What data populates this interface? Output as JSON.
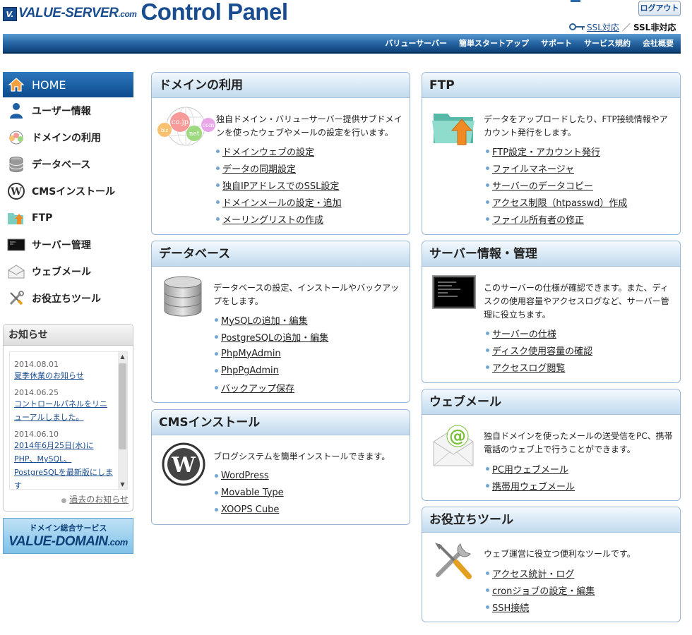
{
  "header": {
    "logo_mark": "V.",
    "brand": "VALUE-SERVER",
    "brand_suffix": ".com",
    "title": "Control Panel",
    "logout_label": "ログアウト",
    "ssl_on_label": "SSL対応",
    "ssl_separator": "／",
    "ssl_off_label": "SSL非対応"
  },
  "topnav": {
    "items": [
      "バリューサーバー",
      "簡単スタートアップ",
      "サポート",
      "サービス規約",
      "会社概要"
    ]
  },
  "sidebar": {
    "items": [
      {
        "label": "HOME",
        "icon": "home-icon"
      },
      {
        "label": "ユーザー情報",
        "icon": "user-icon"
      },
      {
        "label": "ドメインの利用",
        "icon": "domain-icon"
      },
      {
        "label": "データベース",
        "icon": "database-icon"
      },
      {
        "label": "CMSインストール",
        "icon": "wordpress-icon"
      },
      {
        "label": "FTP",
        "icon": "ftp-folder-icon"
      },
      {
        "label": "サーバー管理",
        "icon": "server-icon"
      },
      {
        "label": "ウェブメール",
        "icon": "mail-icon"
      },
      {
        "label": "お役立ちツール",
        "icon": "tools-icon"
      }
    ]
  },
  "news": {
    "title": "お知らせ",
    "items": [
      {
        "date": "2014.08.01",
        "text": "夏季休業のお知らせ"
      },
      {
        "date": "2014.06.25",
        "text": "コントロールパネルをリニューアルしました。"
      },
      {
        "date": "2014.06.10",
        "text": "2014年6月25日(水)にPHP、MySQL、PostgreSQLを最新版にします"
      }
    ],
    "past_link": "過去のお知らせ"
  },
  "banner": {
    "top": "ドメイン総合サービス",
    "main": "VALUE-DOMAIN",
    "suffix": ".com"
  },
  "panels": {
    "domain": {
      "title": "ドメインの利用",
      "icon_labels": [
        "biz",
        "co.jp",
        "net",
        "com"
      ],
      "desc": "独自ドメイン・バリューサーバー提供サブドメインを使ったウェブやメールの設定を行います。",
      "links": [
        "ドメインウェブの設定",
        "データの同期設定",
        "独自IPアドレスでのSSL設定",
        "ドメインメールの設定・追加",
        "メーリングリストの作成"
      ]
    },
    "ftp": {
      "title": "FTP",
      "desc": "データをアップロードしたり、FTP接続情報やアカウント発行をします。",
      "links": [
        "FTP設定・アカウント発行",
        "ファイルマネージャ",
        "サーバーのデータコピー",
        "アクセス制限（htpasswd）作成",
        "ファイル所有者の修正"
      ]
    },
    "database": {
      "title": "データベース",
      "desc": "データベースの設定、インストールやバックアップをします。",
      "links": [
        "MySQLの追加・編集",
        "PostgreSQLの追加・編集",
        "PhpMyAdmin",
        "PhpPgAdmin",
        "バックアップ保存"
      ]
    },
    "server": {
      "title": "サーバー情報・管理",
      "desc": "このサーバーの仕様が確認できます。また、ディスクの使用容量やアクセスログなど、サーバー管理に役立ちます。",
      "links": [
        "サーバーの仕様",
        "ディスク使用容量の確認",
        "アクセスログ閲覧"
      ]
    },
    "cms": {
      "title": "CMSインストール",
      "desc": "ブログシステムを簡単インストールできます。",
      "links": [
        "WordPress",
        "Movable Type",
        "XOOPS Cube"
      ]
    },
    "webmail": {
      "title": "ウェブメール",
      "desc": "独自ドメインを使ったメールの送受信をPC、携帯電話のウェブ上で行うことができます。",
      "links": [
        "PC用ウェブメール",
        "携帯用ウェブメール"
      ]
    },
    "tools": {
      "title": "お役立ちツール",
      "desc": "ウェブ運営に役立つ便利なツールです。",
      "links": [
        "アクセス統計・ログ",
        "cronジョブの設定・編集",
        "SSH接続"
      ]
    }
  },
  "colors": {
    "brand_blue": "#1a4d8f",
    "nav_gradient_top": "#5b9bd1",
    "nav_gradient_bottom": "#0d3f78",
    "panel_border": "#9ab6d2",
    "link_dot": "#74a7d6"
  }
}
